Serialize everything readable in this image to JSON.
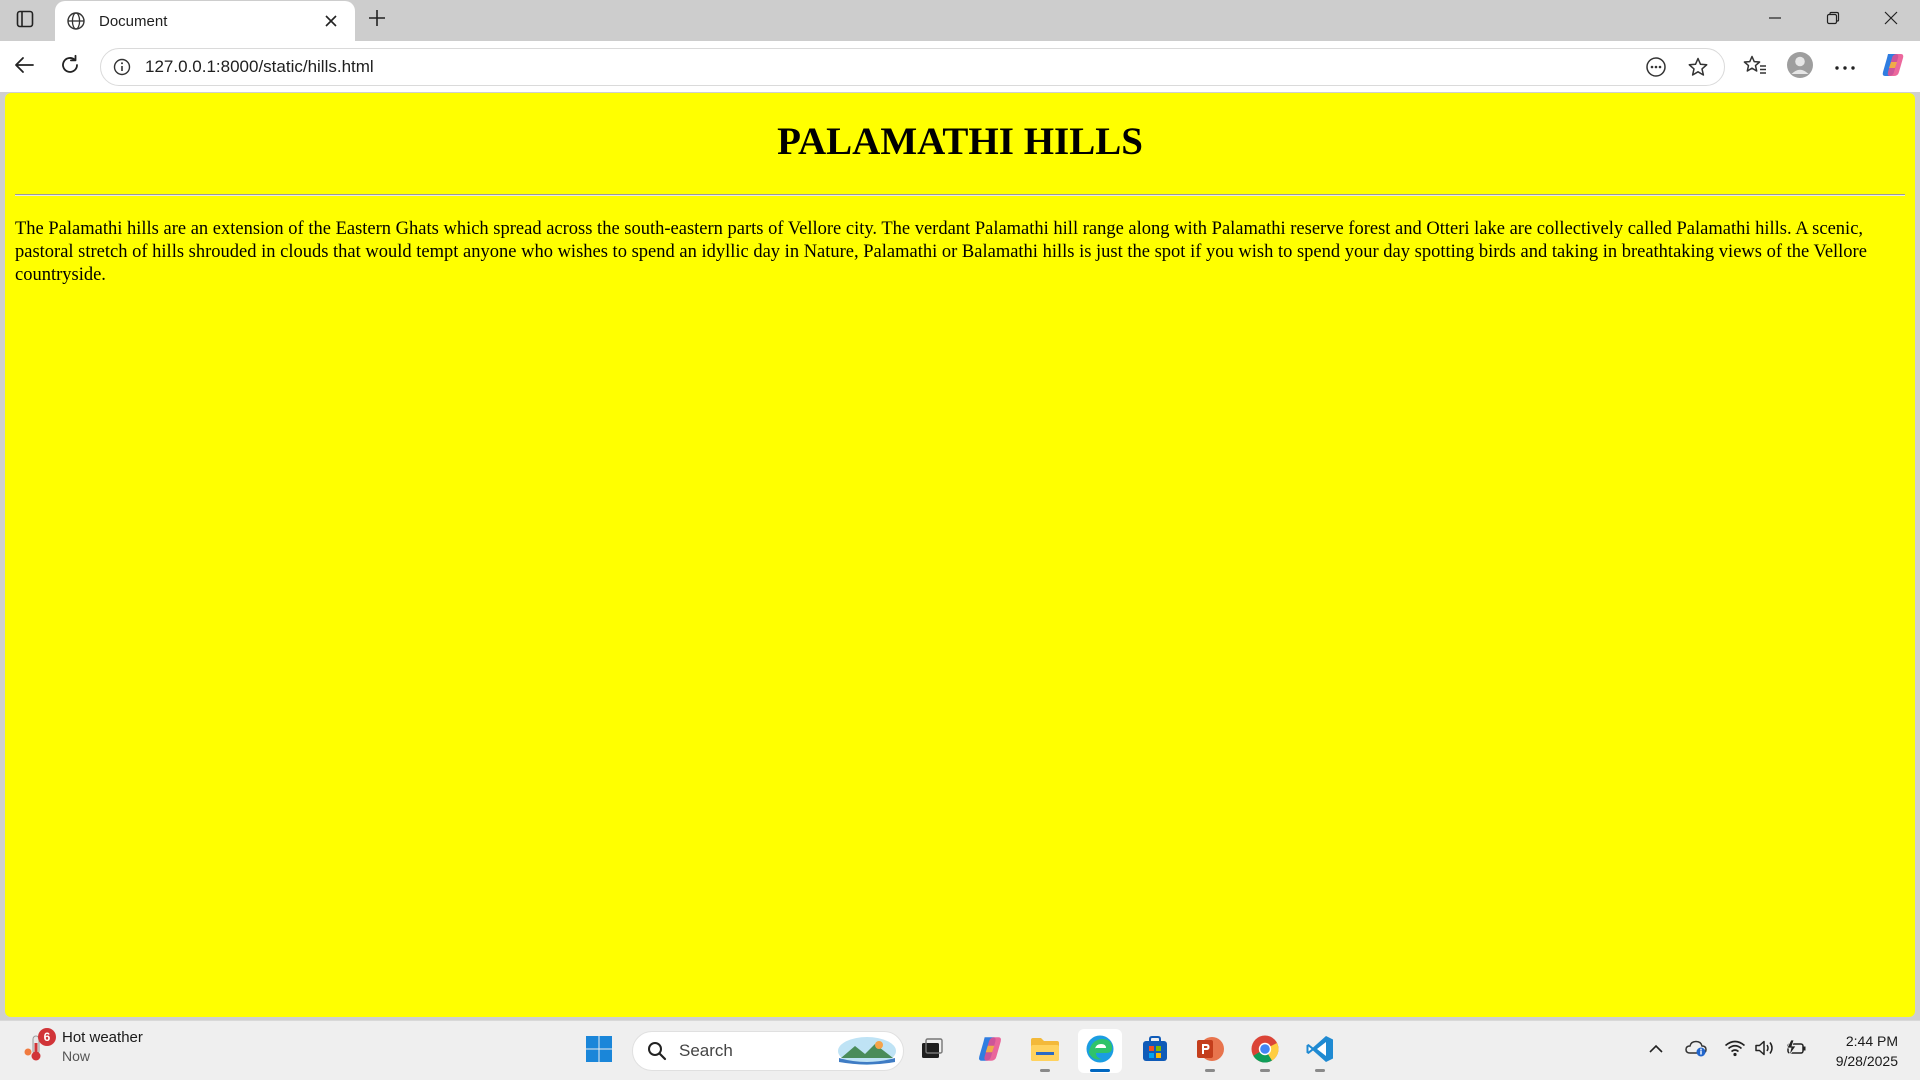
{
  "browser": {
    "tab_title": "Document",
    "url": "127.0.0.1:8000/static/hills.html"
  },
  "page": {
    "heading": "PALAMATHI HILLS",
    "paragraph": "The Palamathi hills are an extension of the Eastern Ghats which spread across the south-eastern parts of Vellore city. The verdant Palamathi hill range along with Palamathi reserve forest and Otteri lake are collectively called Palamathi hills. A scenic, pastoral stretch of hills shrouded in clouds that would tempt anyone who wishes to spend an idyllic day in Nature, Palamathi or Balamathi hills is just the spot if you wish to spend your day spotting birds and taking in breathtaking views of the Vellore countryside.",
    "background_color": "#ffff00"
  },
  "taskbar": {
    "weather_title": "Hot weather",
    "weather_sub": "Now",
    "weather_badge": "6",
    "search_label": "Search",
    "time": "2:44 PM",
    "date": "9/28/2025"
  },
  "icons": {
    "tab_actions": "tab-actions-icon",
    "favicon": "globe-icon",
    "tab_close": "close-icon",
    "new_tab": "plus-icon",
    "minimize": "minimize-icon",
    "restore": "restore-icon",
    "close": "close-icon",
    "back": "back-arrow-icon",
    "refresh": "refresh-icon",
    "site_info": "info-icon",
    "read_aloud": "reading-icon",
    "favorite": "star-icon",
    "favorites": "favorites-icon",
    "profile": "profile-icon",
    "more": "more-icon",
    "copilot": "copilot-icon"
  }
}
